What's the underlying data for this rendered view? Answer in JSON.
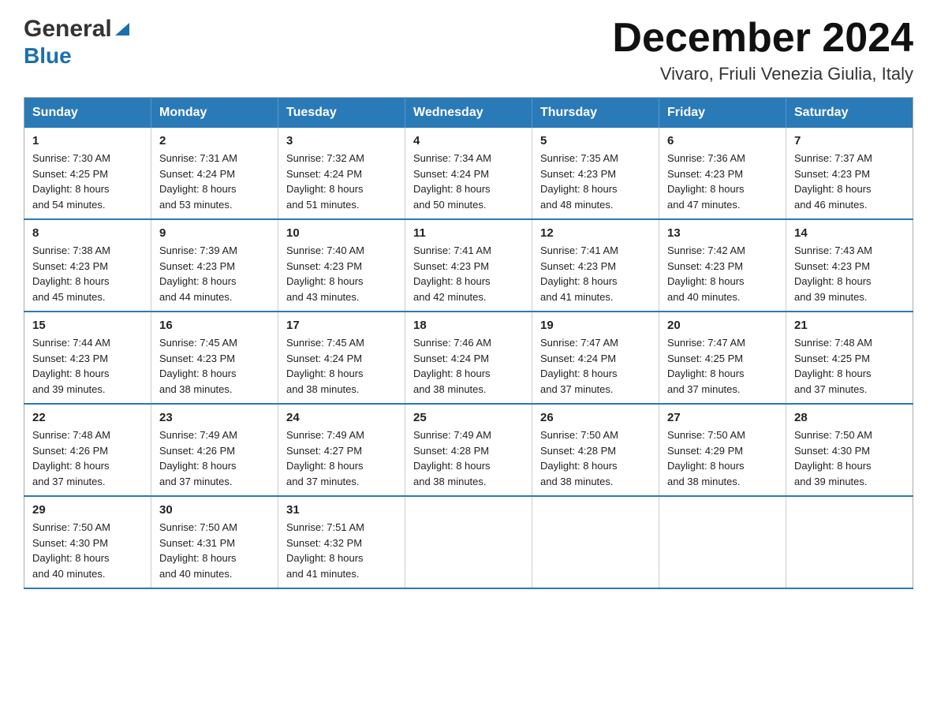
{
  "header": {
    "logo_general": "General",
    "logo_blue": "Blue",
    "title": "December 2024",
    "subtitle": "Vivaro, Friuli Venezia Giulia, Italy"
  },
  "days_of_week": [
    "Sunday",
    "Monday",
    "Tuesday",
    "Wednesday",
    "Thursday",
    "Friday",
    "Saturday"
  ],
  "weeks": [
    [
      {
        "day": "1",
        "sunrise": "7:30 AM",
        "sunset": "4:25 PM",
        "daylight": "8 hours and 54 minutes."
      },
      {
        "day": "2",
        "sunrise": "7:31 AM",
        "sunset": "4:24 PM",
        "daylight": "8 hours and 53 minutes."
      },
      {
        "day": "3",
        "sunrise": "7:32 AM",
        "sunset": "4:24 PM",
        "daylight": "8 hours and 51 minutes."
      },
      {
        "day": "4",
        "sunrise": "7:34 AM",
        "sunset": "4:24 PM",
        "daylight": "8 hours and 50 minutes."
      },
      {
        "day": "5",
        "sunrise": "7:35 AM",
        "sunset": "4:23 PM",
        "daylight": "8 hours and 48 minutes."
      },
      {
        "day": "6",
        "sunrise": "7:36 AM",
        "sunset": "4:23 PM",
        "daylight": "8 hours and 47 minutes."
      },
      {
        "day": "7",
        "sunrise": "7:37 AM",
        "sunset": "4:23 PM",
        "daylight": "8 hours and 46 minutes."
      }
    ],
    [
      {
        "day": "8",
        "sunrise": "7:38 AM",
        "sunset": "4:23 PM",
        "daylight": "8 hours and 45 minutes."
      },
      {
        "day": "9",
        "sunrise": "7:39 AM",
        "sunset": "4:23 PM",
        "daylight": "8 hours and 44 minutes."
      },
      {
        "day": "10",
        "sunrise": "7:40 AM",
        "sunset": "4:23 PM",
        "daylight": "8 hours and 43 minutes."
      },
      {
        "day": "11",
        "sunrise": "7:41 AM",
        "sunset": "4:23 PM",
        "daylight": "8 hours and 42 minutes."
      },
      {
        "day": "12",
        "sunrise": "7:41 AM",
        "sunset": "4:23 PM",
        "daylight": "8 hours and 41 minutes."
      },
      {
        "day": "13",
        "sunrise": "7:42 AM",
        "sunset": "4:23 PM",
        "daylight": "8 hours and 40 minutes."
      },
      {
        "day": "14",
        "sunrise": "7:43 AM",
        "sunset": "4:23 PM",
        "daylight": "8 hours and 39 minutes."
      }
    ],
    [
      {
        "day": "15",
        "sunrise": "7:44 AM",
        "sunset": "4:23 PM",
        "daylight": "8 hours and 39 minutes."
      },
      {
        "day": "16",
        "sunrise": "7:45 AM",
        "sunset": "4:23 PM",
        "daylight": "8 hours and 38 minutes."
      },
      {
        "day": "17",
        "sunrise": "7:45 AM",
        "sunset": "4:24 PM",
        "daylight": "8 hours and 38 minutes."
      },
      {
        "day": "18",
        "sunrise": "7:46 AM",
        "sunset": "4:24 PM",
        "daylight": "8 hours and 38 minutes."
      },
      {
        "day": "19",
        "sunrise": "7:47 AM",
        "sunset": "4:24 PM",
        "daylight": "8 hours and 37 minutes."
      },
      {
        "day": "20",
        "sunrise": "7:47 AM",
        "sunset": "4:25 PM",
        "daylight": "8 hours and 37 minutes."
      },
      {
        "day": "21",
        "sunrise": "7:48 AM",
        "sunset": "4:25 PM",
        "daylight": "8 hours and 37 minutes."
      }
    ],
    [
      {
        "day": "22",
        "sunrise": "7:48 AM",
        "sunset": "4:26 PM",
        "daylight": "8 hours and 37 minutes."
      },
      {
        "day": "23",
        "sunrise": "7:49 AM",
        "sunset": "4:26 PM",
        "daylight": "8 hours and 37 minutes."
      },
      {
        "day": "24",
        "sunrise": "7:49 AM",
        "sunset": "4:27 PM",
        "daylight": "8 hours and 37 minutes."
      },
      {
        "day": "25",
        "sunrise": "7:49 AM",
        "sunset": "4:28 PM",
        "daylight": "8 hours and 38 minutes."
      },
      {
        "day": "26",
        "sunrise": "7:50 AM",
        "sunset": "4:28 PM",
        "daylight": "8 hours and 38 minutes."
      },
      {
        "day": "27",
        "sunrise": "7:50 AM",
        "sunset": "4:29 PM",
        "daylight": "8 hours and 38 minutes."
      },
      {
        "day": "28",
        "sunrise": "7:50 AM",
        "sunset": "4:30 PM",
        "daylight": "8 hours and 39 minutes."
      }
    ],
    [
      {
        "day": "29",
        "sunrise": "7:50 AM",
        "sunset": "4:30 PM",
        "daylight": "8 hours and 40 minutes."
      },
      {
        "day": "30",
        "sunrise": "7:50 AM",
        "sunset": "4:31 PM",
        "daylight": "8 hours and 40 minutes."
      },
      {
        "day": "31",
        "sunrise": "7:51 AM",
        "sunset": "4:32 PM",
        "daylight": "8 hours and 41 minutes."
      },
      null,
      null,
      null,
      null
    ]
  ],
  "labels": {
    "sunrise": "Sunrise:",
    "sunset": "Sunset:",
    "daylight": "Daylight:"
  }
}
